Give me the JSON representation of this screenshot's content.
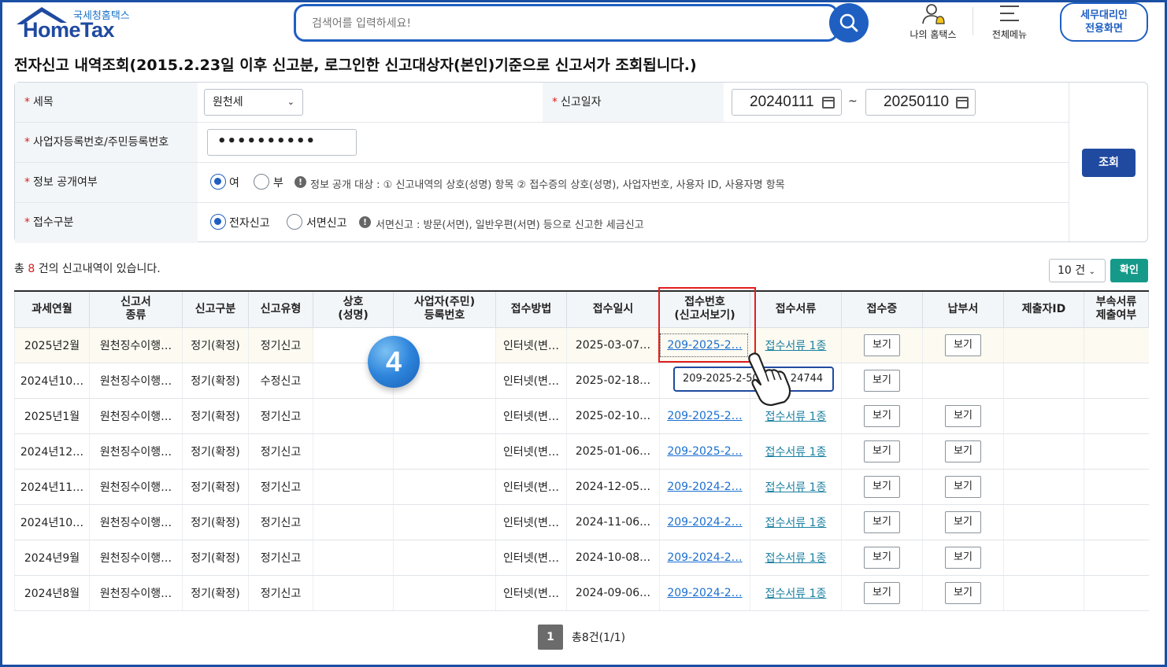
{
  "header": {
    "logo_small": "국세청홈택스",
    "logo_big": "HomeTax",
    "search_placeholder": "검색어를 입력하세요!",
    "nav": [
      {
        "label": "나의 홈택스",
        "icon": "user-bell-icon"
      },
      {
        "label": "전체메뉴",
        "icon": "menu-icon"
      }
    ],
    "agent_button_line1": "세무대리인",
    "agent_button_line2": "전용화면"
  },
  "page_title": "전자신고 내역조회(2015.2.23일 이후 신고분, 로그인한  신고대상자(본인)기준으로  신고서가 조회됩니다.)",
  "form": {
    "tax_item": {
      "label": "세목",
      "value": "원천세"
    },
    "filing_date": {
      "label": "신고일자",
      "from": "20240111",
      "tilde": "~",
      "to": "20250110"
    },
    "id_number": {
      "label": "사업자등록번호/주민등록번호",
      "value": "••••••••••"
    },
    "disclosure": {
      "label": "정보 공개여부",
      "options": [
        "여",
        "부"
      ],
      "selected": "여",
      "note": "정보 공개 대상 : ① 신고내역의 상호(성명) 항목 ② 접수증의 상호(성명), 사업자번호, 사용자 ID, 사용자명 항목"
    },
    "receipt_type": {
      "label": "접수구분",
      "options": [
        "전자신고",
        "서면신고"
      ],
      "selected": "전자신고",
      "note": "서면신고 : 방문(서면), 일반우편(서면) 등으로 신고한 세금신고"
    },
    "query_button": "조회"
  },
  "results": {
    "total_prefix": "총",
    "total_count": "8",
    "total_suffix": "건의 신고내역이 있습니다.",
    "page_size": "10 건",
    "confirm_button": "확인"
  },
  "table": {
    "headers": [
      [
        "과세연월"
      ],
      [
        "신고서",
        "종류"
      ],
      [
        "신고구분"
      ],
      [
        "신고유형"
      ],
      [
        "상호",
        "(성명)"
      ],
      [
        "사업자(주민)",
        "등록번호"
      ],
      [
        "접수방법"
      ],
      [
        "접수일시"
      ],
      [
        "접수번호",
        "(신고서보기)"
      ],
      [
        "접수서류"
      ],
      [
        "접수증"
      ],
      [
        "납부서"
      ],
      [
        "제출자ID"
      ],
      [
        "부속서류",
        "제출여부"
      ]
    ],
    "view_label": "보기",
    "rows": [
      {
        "period": "2025년2월",
        "form": "원천징수이행…",
        "category": "정기(확정)",
        "type": "정기신고",
        "name": "",
        "reg_no": "",
        "method": "인터넷(변…",
        "datetime": "2025-03-07…",
        "receipt_no": "209-2025-2…",
        "docs": "접수서류 1종",
        "receipt": "보기",
        "payment": "보기"
      },
      {
        "period": "2024년10…",
        "form": "원천징수이행…",
        "category": "정기(확정)",
        "type": "수정신고",
        "name": "",
        "reg_no": "",
        "method": "인터넷(변…",
        "datetime": "2025-02-18…",
        "receipt_no": "20",
        "docs": "",
        "receipt": "보기",
        "payment": ""
      },
      {
        "period": "2025년1월",
        "form": "원천징수이행…",
        "category": "정기(확정)",
        "type": "정기신고",
        "name": "",
        "reg_no": "",
        "method": "인터넷(변…",
        "datetime": "2025-02-10…",
        "receipt_no": "209-2025-2…",
        "docs": "접수서류 1종",
        "receipt": "보기",
        "payment": "보기"
      },
      {
        "period": "2024년12…",
        "form": "원천징수이행…",
        "category": "정기(확정)",
        "type": "정기신고",
        "name": "",
        "reg_no": "",
        "method": "인터넷(변…",
        "datetime": "2025-01-06…",
        "receipt_no": "209-2025-2…",
        "docs": "접수서류 1종",
        "receipt": "보기",
        "payment": "보기"
      },
      {
        "period": "2024년11…",
        "form": "원천징수이행…",
        "category": "정기(확정)",
        "type": "정기신고",
        "name": "",
        "reg_no": "",
        "method": "인터넷(변…",
        "datetime": "2024-12-05…",
        "receipt_no": "209-2024-2…",
        "docs": "접수서류 1종",
        "receipt": "보기",
        "payment": "보기"
      },
      {
        "period": "2024년10…",
        "form": "원천징수이행…",
        "category": "정기(확정)",
        "type": "정기신고",
        "name": "",
        "reg_no": "",
        "method": "인터넷(변…",
        "datetime": "2024-11-06…",
        "receipt_no": "209-2024-2…",
        "docs": "접수서류 1종",
        "receipt": "보기",
        "payment": "보기"
      },
      {
        "period": "2024년9월",
        "form": "원천징수이행…",
        "category": "정기(확정)",
        "type": "정기신고",
        "name": "",
        "reg_no": "",
        "method": "인터넷(변…",
        "datetime": "2024-10-08…",
        "receipt_no": "209-2024-2…",
        "docs": "접수서류 1종",
        "receipt": "보기",
        "payment": "보기"
      },
      {
        "period": "2024년8월",
        "form": "원천징수이행…",
        "category": "정기(확정)",
        "type": "정기신고",
        "name": "",
        "reg_no": "",
        "method": "인터넷(변…",
        "datetime": "2024-09-06…",
        "receipt_no": "209-2024-2…",
        "docs": "접수서류 1종",
        "receipt": "보기",
        "payment": "보기"
      }
    ]
  },
  "tooltip": "209-2025-2-50",
  "tooltip_tail": "24744",
  "step_badge": "4",
  "pager": {
    "current": "1",
    "info": "총8건(1/1)"
  },
  "colors": {
    "brand_blue": "#1f4aa0",
    "accent_blue": "#1f5fc2",
    "required_red": "#d61f1f",
    "highlight_red": "#e21e1e",
    "confirm_teal": "#159a8a"
  }
}
